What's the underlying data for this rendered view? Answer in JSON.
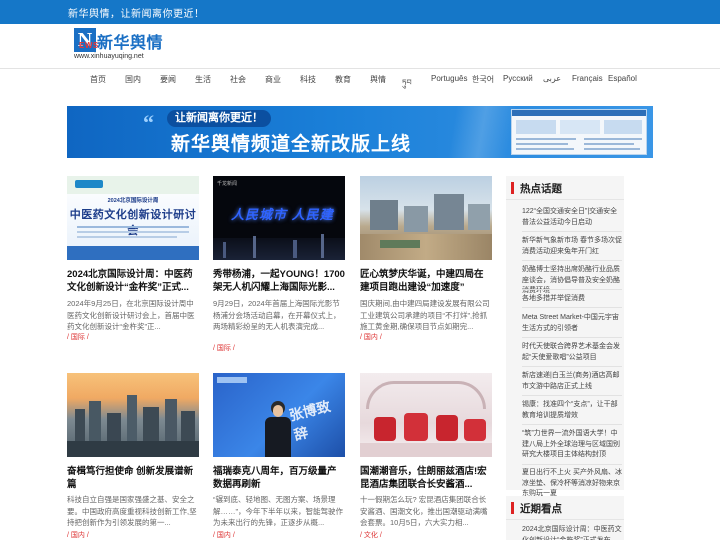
{
  "topbar": {
    "slogan": "新华舆情，让新闻离你更近！"
  },
  "logo": {
    "letter": "N",
    "sub": "EWS",
    "name": "新华舆情",
    "url": "www.xinhuayuqing.net"
  },
  "nav": [
    {
      "label": "首页"
    },
    {
      "label": "国内"
    },
    {
      "label": "要闻"
    },
    {
      "label": "生活"
    },
    {
      "label": "社会"
    },
    {
      "label": "商业"
    },
    {
      "label": "科技"
    },
    {
      "label": "教育"
    },
    {
      "label": "舆情"
    },
    {
      "label": "ཏུབ"
    },
    {
      "label": "Português"
    },
    {
      "label": "한국어"
    },
    {
      "label": "Русский"
    },
    {
      "label": "عربى"
    },
    {
      "label": "Français"
    },
    {
      "label": "Español"
    }
  ],
  "banner": {
    "tag": "让新闻离你更近！",
    "title": "新华舆情频道全新改版上线"
  },
  "articles": [
    {
      "title": "2024北京国际设计周：中医药文化创新设计“金杵奖”正式...",
      "summary": "2024年9月25日，在北京国际设计周中医药文化创新设计研讨会上，首届中医药文化创新设计“金杵奖”正...",
      "tag": "/ 国际 /",
      "img_text": "中医药文化创新设计研讨会",
      "img_small": "2024北京国际设计周"
    },
    {
      "title": "秀带杨浦，一起YOUNG！1700架无人机闪耀上海国际光影...",
      "summary": "9月29日，2024年首届上海国际光影节杨浦分会场活动启幕，在开幕仪式上，两场精彩纷呈的无人机表演完成...",
      "tag": "/ 国际 /",
      "img_text": "人民城市 人民建"
    },
    {
      "title": "匠心筑梦庆华诞，中建四局在建项目跑出建设“加速度”",
      "summary": "国庆期间,由中建四局建设发展有限公司工业建筑公司承建的项目“不打烊”,抢抓施工黄金期,确保项目节点如期完...",
      "tag": "/ 国内 /"
    },
    {
      "title": "奋楫笃行担使命 创新发展谱新篇",
      "summary": "科技自立自强是国家强盛之基、安全之要。中国政府高度重视科技创新工作,坚持把创新作为引领发展的第一...",
      "tag": "/ 国内 /"
    },
    {
      "title": "福瑞泰克八周年，百万级量产数据再刷新",
      "summary": "“辗到底、轻地图、无图方案、场景理解……”，今年下半年以来，智能驾驶作为未来出行的先锋，正逐步从概...",
      "tag": "/ 国内 /",
      "img_text": "张博致辞"
    },
    {
      "title": "国潮潮音乐，住朗丽兹酒店!宏昆酒店集团联合长安酱酒...",
      "summary": "十一假期怎么玩? 宏昆酒店集团联合长安酱酒、国潮文化，推出国潮驱动满嘴会套票。10月5日，六大实力相...",
      "tag": "/ 文化 /"
    }
  ],
  "hot": {
    "heading": "热点话题",
    "items": [
      "122“全国交通安全日”|交通安全普法公益活动今日启动",
      "新华新气象新市场 春节多场次促消费活动迎来兔年开门红",
      "奶酪博士坚持出席奶酪行业品质座谈会，消协倡导普及安全奶酪消费环境",
      "各地多措并举促消费",
      "Meta Street Market-中国元宇宙生活方式的引领者",
      "时代天使联合跨界艺术基金会发起“天使爱歌唱”公益项目",
      "新店速递|白玉兰(商务)酒店高邮市文游中路店正式上线",
      "锡康：找准四个“支点”，让干部教育培训提质增效",
      "“筑”力世界一流外国语大学！中建八局上外全球治理与区域国别研究大楼项目主体结构封顶",
      "夏日出行不上火 买产外风扇、冰凉坐垫、保冷杯等消凉好物来京东购玩一夏"
    ]
  },
  "recent": {
    "heading": "近期看点",
    "items": [
      "2024北京国际设计周：中医药文化创新设计“金杵奖”正式发布"
    ]
  }
}
